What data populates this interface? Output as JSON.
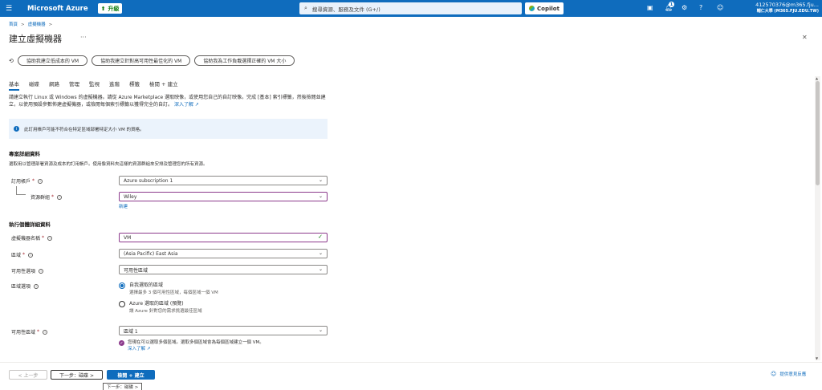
{
  "topbar": {
    "brand": "Microsoft Azure",
    "upgrade": "升級",
    "search_placeholder": "搜尋資源、服務及文件 (G+/)",
    "copilot": "Copilot",
    "notification_count": "1",
    "user": "412570376@m365.fju...",
    "org": "輔仁大學 (M365.FJU.EDU.TW)"
  },
  "breadcrumb": [
    "首頁",
    "虛擬機器"
  ],
  "title": "建立虛擬機器",
  "helpers": [
    "協助我建立低成本的 VM",
    "協助我建立針對高可用性最佳化的 VM",
    "協助我為工作負載選擇正確的 VM 大小"
  ],
  "tabs": [
    "基本",
    "磁碟",
    "網路",
    "管理",
    "監視",
    "進階",
    "標籤",
    "檢閱 + 建立"
  ],
  "intro": {
    "text": "請建立執行 Linux 或 Windows 的虛擬機器。請從 Azure Marketplace 選取映像，或使用您自己的自訂映像。完成 [基本] 索引標籤，然後檢閱並建立，以使用預設參數佈建虛擬機器，或檢閱每個索引標籤以獲得完全的自訂。",
    "learn_more": "深入了解 ↗"
  },
  "info_banner": "此訂用帳戶可能不符合在特定區域部署特定大小 VM 的資格。",
  "project": {
    "heading": "專案詳細資料",
    "desc": "選取用以管理部署資源及成本的訂用帳戶。使用像資料夾這樣的資源群組來安排及管理您的所有資源。",
    "subscription_label": "訂用帳戶",
    "subscription_value": "Azure subscription 1",
    "rg_label": "資源群組",
    "rg_value": "Wiley",
    "new_link": "新建"
  },
  "instance": {
    "heading": "執行個體詳細資料",
    "vm_name_label": "虛擬機器名稱",
    "vm_name_value": "VM",
    "region_label": "區域",
    "region_value": "(Asia Pacific) East Asia",
    "availability_label": "可用性選項",
    "availability_value": "可用性區域",
    "zone_option_label": "區域選項",
    "radio1_title": "自我選取的區域",
    "radio1_sub": "選擇最多 3 個可用性區域，每個區域一個 VM",
    "radio2_title": "Azure 選取的區域 (預覽)",
    "radio2_sub": "讓 Azure 針對您的需求挑選最佳區域",
    "zone_label": "可用性區域",
    "zone_value": "區域 1",
    "note_text": "您現在可以選取多個區域。選取多個區域會為每個區域建立一個 VM。",
    "note_link": "深入了解 ↗"
  },
  "footer": {
    "prev": "< 上一步",
    "next": "下一步：磁碟 >",
    "create": "檢閱 + 建立",
    "tooltip": "下一步：磁碟 >",
    "feedback": "提供意見反應"
  }
}
